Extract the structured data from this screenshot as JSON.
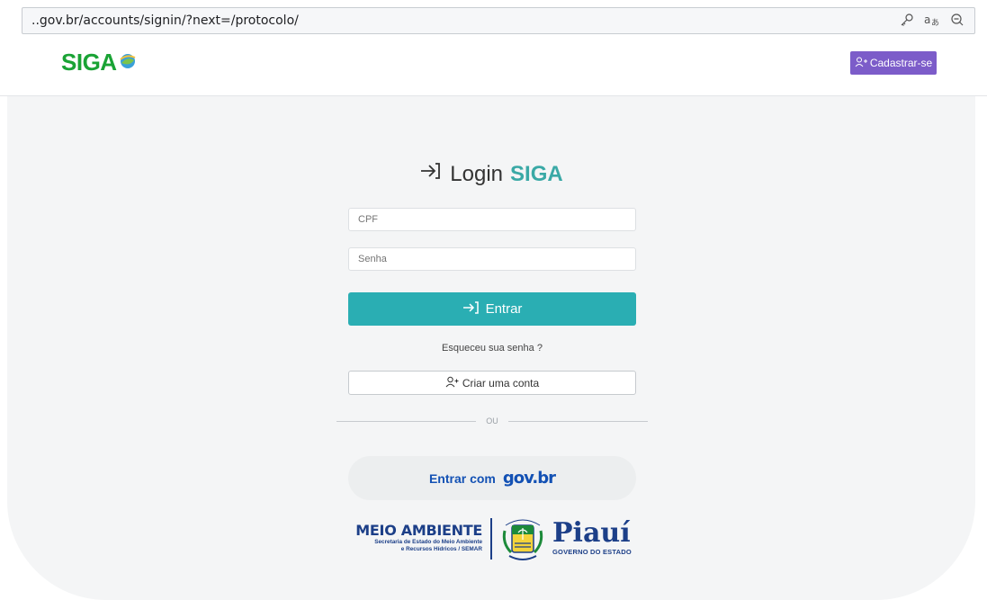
{
  "browser": {
    "url": "..gov.br/accounts/signin/?next=/protocolo/",
    "icons": [
      "key-icon",
      "translate-icon",
      "zoom-out-icon"
    ]
  },
  "header": {
    "logo_text": "SIGA",
    "register_label": "Cadastrar-se"
  },
  "login": {
    "title_prefix": "Login",
    "title_brand": "SIGA",
    "cpf_placeholder": "CPF",
    "cpf_value": "",
    "password_placeholder": "Senha",
    "password_value": "",
    "submit_label": "Entrar",
    "forgot_label": "Esqueceu sua senha ?",
    "create_account_label": "Criar uma conta",
    "divider_label": "OU",
    "govbr_label": "Entrar com",
    "govbr_logo_text": "gov.br"
  },
  "footer": {
    "agency_title": "MEIO AMBIENTE",
    "agency_sub1": "Secretaria de Estado do Meio Ambiente",
    "agency_sub2": "e Recursos Hídricos / SEMAR",
    "state_title": "Piauí",
    "state_sub": "GOVERNO DO ESTADO"
  },
  "colors": {
    "primary_teal": "#2aaeb3",
    "register_purple": "#7c5cc9",
    "logo_green": "#1aa335",
    "brand_navy": "#1c3f88"
  }
}
